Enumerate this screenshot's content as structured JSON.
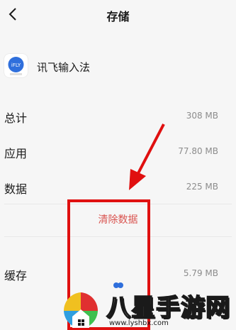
{
  "header": {
    "title": "存储"
  },
  "app": {
    "name": "讯飞输入法",
    "icon_text": "iFLY"
  },
  "storage": {
    "rows": [
      {
        "label": "总计",
        "value": "308 MB"
      },
      {
        "label": "应用",
        "value": "77.80 MB"
      },
      {
        "label": "数据",
        "value": "225 MB"
      }
    ],
    "clear_data": "清除数据",
    "cache": {
      "label": "缓存",
      "value": "5.79 MB"
    }
  },
  "watermark": {
    "text": "八星手游网",
    "url": "www.lyshbx.com"
  },
  "colors": {
    "accent_red": "#d9534f",
    "annotation_red": "#e01010"
  }
}
